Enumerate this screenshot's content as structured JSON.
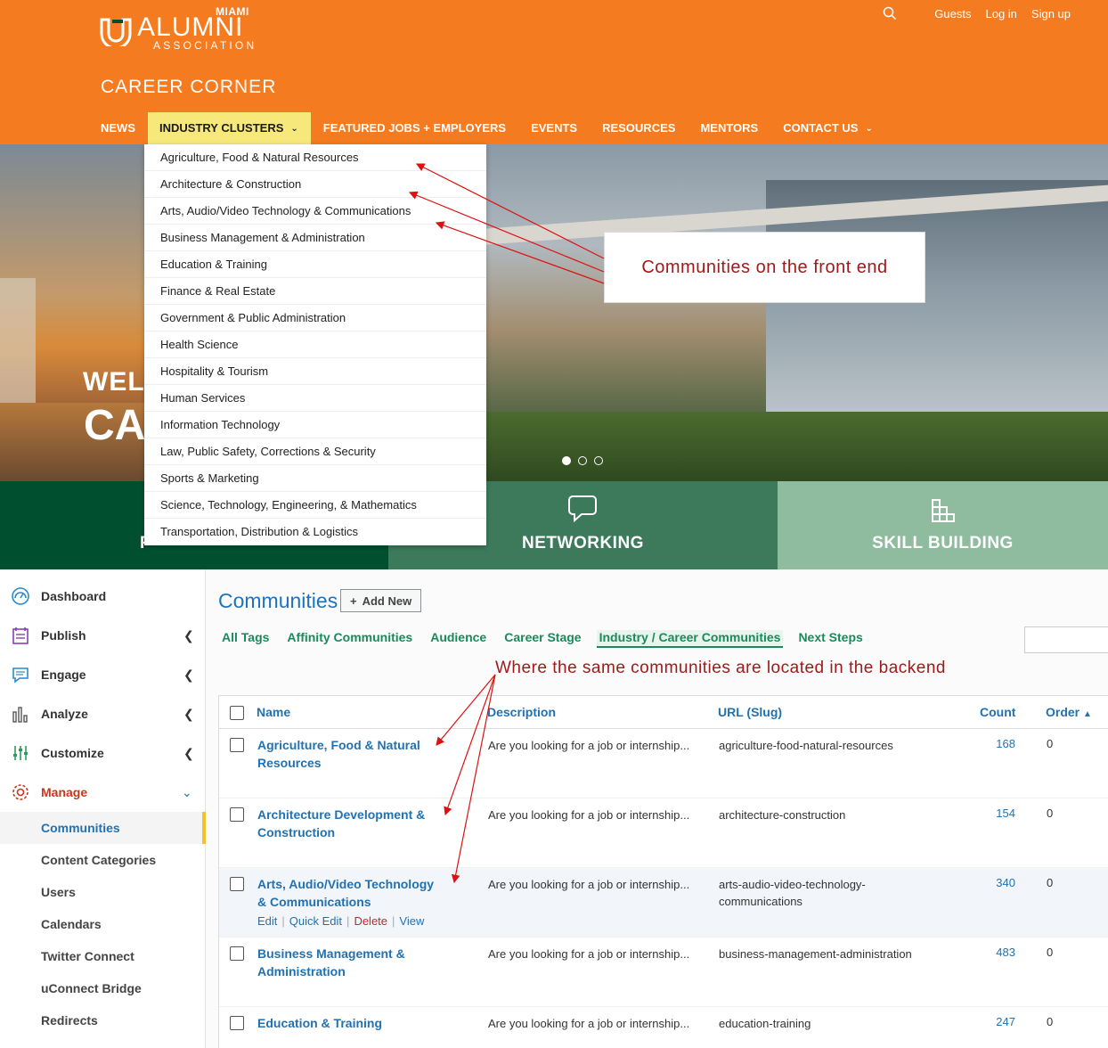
{
  "brand": {
    "miami": "MIAMI",
    "alumni": "ALUMNI",
    "association": "ASSOCIATION",
    "site_title": "CAREER CORNER"
  },
  "top_links": [
    "Guests",
    "Log in",
    "Sign up"
  ],
  "main_nav": [
    "NEWS",
    "INDUSTRY CLUSTERS",
    "FEATURED JOBS + EMPLOYERS",
    "EVENTS",
    "RESOURCES",
    "MENTORS",
    "CONTACT US"
  ],
  "hero": {
    "welcome": "WELC",
    "ca": "CA"
  },
  "tiles": [
    "F",
    "NETWORKING",
    "SKILL BUILDING"
  ],
  "dropdown": [
    "Agriculture, Food & Natural Resources",
    "Architecture & Construction",
    "Arts, Audio/Video Technology & Communications",
    "Business Management & Administration",
    "Education & Training",
    "Finance & Real Estate",
    "Government & Public Administration",
    "Health Science",
    "Hospitality & Tourism",
    "Human Services",
    "Information Technology",
    "Law, Public Safety, Corrections & Security",
    "Sports & Marketing",
    "Science, Technology, Engineering, & Mathematics",
    "Transportation, Distribution & Logistics"
  ],
  "callout": "Communities on the front end",
  "note": "Where the same communities are located in the backend",
  "sidebar": {
    "menu": [
      "Dashboard",
      "Publish",
      "Engage",
      "Analyze",
      "Customize",
      "Manage"
    ],
    "submenu": [
      "Communities",
      "Content Categories",
      "Users",
      "Calendars",
      "Twitter Connect",
      "uConnect Bridge",
      "Redirects"
    ]
  },
  "page": {
    "title": "Communities",
    "add_new": "Add New"
  },
  "tabs": [
    "All Tags",
    "Affinity Communities",
    "Audience",
    "Career Stage",
    "Industry / Career Communities",
    "Next Steps"
  ],
  "table": {
    "headers": {
      "name": "Name",
      "description": "Description",
      "slug": "URL (Slug)",
      "count": "Count",
      "order": "Order"
    },
    "rows": [
      {
        "name": "Agriculture, Food & Natural Resources",
        "description": "Are you looking for a job or internship...",
        "slug": "agriculture-food-natural-resources",
        "count": "168",
        "order": "0"
      },
      {
        "name": "Architecture Development & Construction",
        "description": "Are you looking for a job or internship...",
        "slug": "architecture-construction",
        "count": "154",
        "order": "0"
      },
      {
        "name": "Arts, Audio/Video Technology & Communications",
        "description": "Are you looking for a job or internship...",
        "slug": "arts-audio-video-technology-communications",
        "count": "340",
        "order": "0"
      },
      {
        "name": "Business Management & Administration",
        "description": "Are you looking for a job or internship...",
        "slug": "business-management-administration",
        "count": "483",
        "order": "0"
      },
      {
        "name": "Education & Training",
        "description": "Are you looking for a job or internship...",
        "slug": "education-training",
        "count": "247",
        "order": "0"
      }
    ],
    "row_actions": [
      "Edit",
      "Quick Edit",
      "Delete",
      "View"
    ]
  },
  "colors": {
    "orange": "#f47b20",
    "accent_green": "#1a8a5c",
    "link_blue": "#2271b1",
    "annotation_red": "#a1191b"
  }
}
